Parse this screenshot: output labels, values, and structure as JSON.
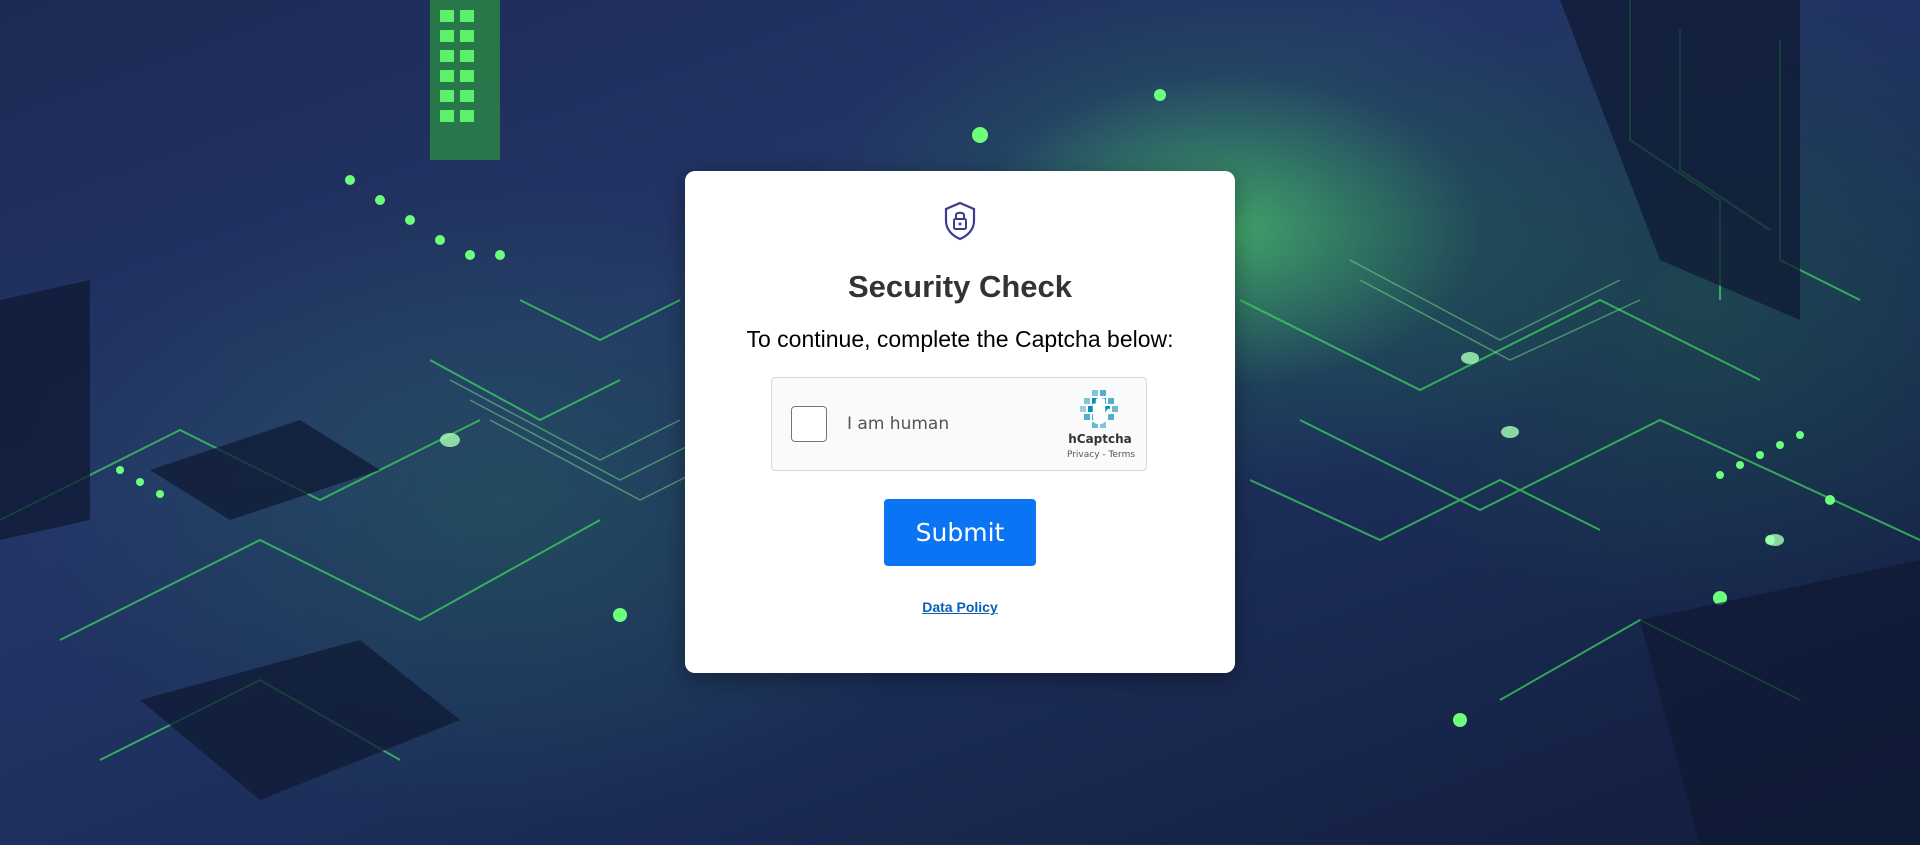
{
  "card": {
    "title": "Security Check",
    "subtitle": "To continue, complete the Captcha below:",
    "shield_icon": "shield-lock-icon"
  },
  "captcha": {
    "checkbox_label": "I am human",
    "brand": "hCaptcha",
    "privacy_link": "Privacy",
    "separator": " - ",
    "terms_link": "Terms",
    "logo_icon": "hcaptcha-hand-icon",
    "checked": false
  },
  "actions": {
    "submit_label": "Submit",
    "data_policy_link": "Data Policy"
  },
  "colors": {
    "submit_bg": "#0a74f4",
    "link": "#0b5fb4",
    "title": "#333333",
    "background_accent": "#3ef06a",
    "background_base": "#1f2f5c"
  }
}
